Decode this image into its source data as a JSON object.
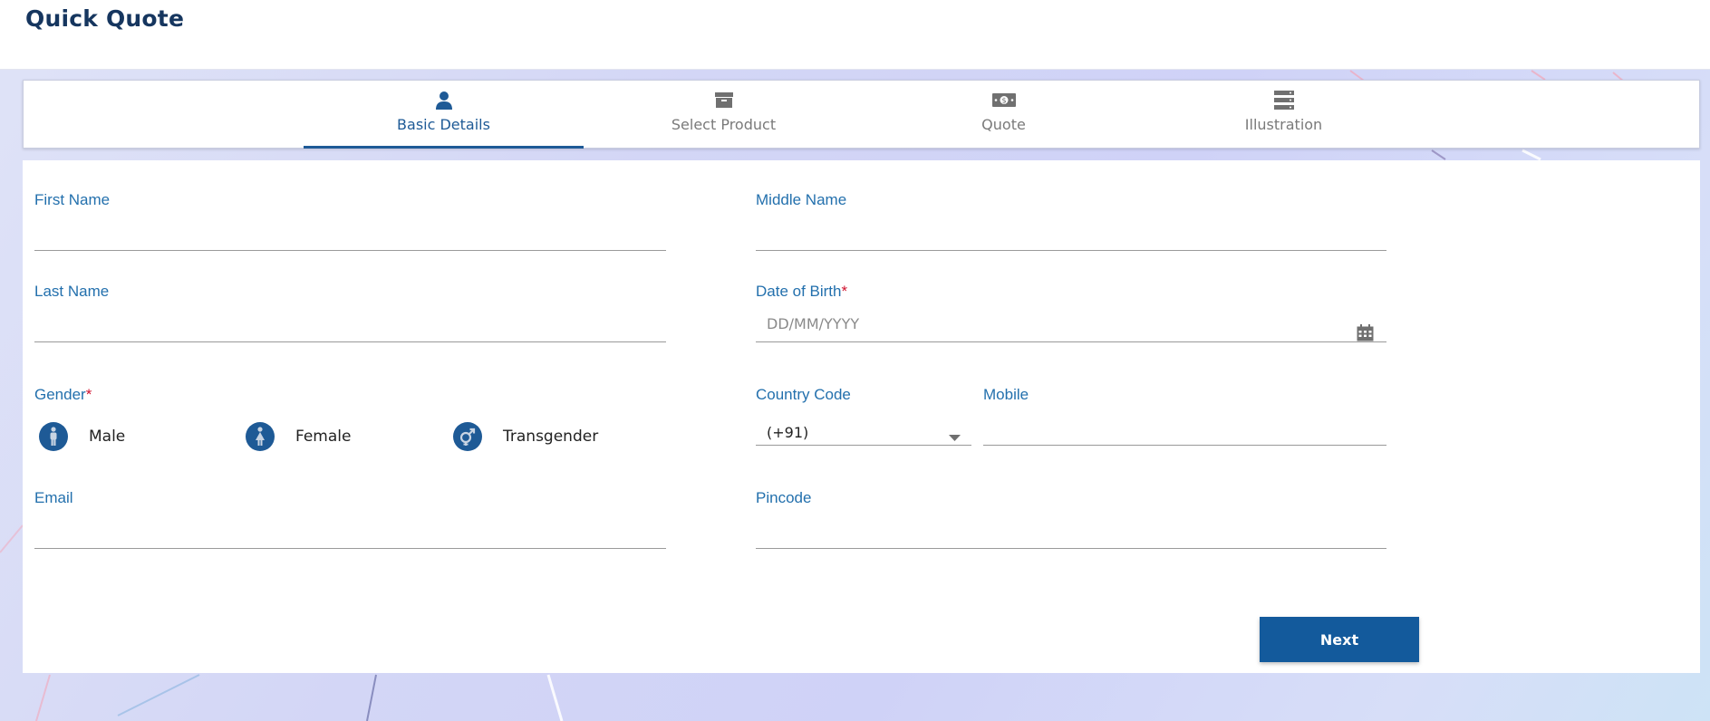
{
  "page": {
    "title": "Quick Quote"
  },
  "steps": [
    {
      "label": "Basic Details",
      "icon": "person-icon",
      "active": true
    },
    {
      "label": "Select Product",
      "icon": "archive-box-icon",
      "active": false
    },
    {
      "label": "Quote",
      "icon": "money-bill-icon",
      "active": false
    },
    {
      "label": "Illustration",
      "icon": "server-stack-icon",
      "active": false
    }
  ],
  "form": {
    "first_name": {
      "label": "First Name",
      "value": ""
    },
    "middle_name": {
      "label": "Middle Name",
      "value": ""
    },
    "last_name": {
      "label": "Last Name",
      "value": ""
    },
    "dob": {
      "label": "Date of Birth",
      "required_mark": "*",
      "placeholder": "DD/MM/YYYY",
      "icon": "calendar-icon"
    },
    "gender": {
      "label": "Gender",
      "required_mark": "*",
      "options": [
        {
          "label": "Male",
          "icon": "male-icon"
        },
        {
          "label": "Female",
          "icon": "female-icon"
        },
        {
          "label": "Transgender",
          "icon": "transgender-icon"
        }
      ]
    },
    "country_code": {
      "label": "Country Code",
      "value": "(+91)",
      "icon": "caret-down-icon"
    },
    "mobile": {
      "label": "Mobile",
      "value": ""
    },
    "email": {
      "label": "Email",
      "value": ""
    },
    "pincode": {
      "label": "Pincode",
      "value": ""
    }
  },
  "actions": {
    "next_label": "Next"
  },
  "colors": {
    "primary": "#1e5a96",
    "title": "#16365f",
    "label": "#2370ad",
    "required": "#d0122e",
    "inactive_tab": "#7a7a7a"
  }
}
